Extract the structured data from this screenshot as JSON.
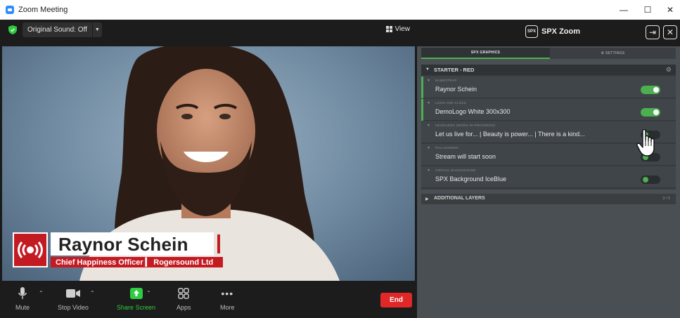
{
  "window": {
    "title": "Zoom Meeting"
  },
  "meeting": {
    "original_sound": "Original Sound: Off",
    "view_label": "View"
  },
  "lower_third": {
    "name": "Raynor Schein",
    "subtitle": "Chief Happiness Officer  ▎ Rogersound Ltd"
  },
  "toolbar": {
    "mute": "Mute",
    "stop_video": "Stop Video",
    "share_screen": "Share Screen",
    "apps": "Apps",
    "more": "More",
    "end": "End"
  },
  "panel": {
    "logo_text": "SPX",
    "title": "SPX Zoom",
    "tabs": {
      "graphics": "SPX GRAPHICS",
      "settings": "⚙ SETTINGS"
    },
    "rundown_title": "STARTER - RED",
    "items": [
      {
        "caption": "NAMESTRAP",
        "text": "Raynor Schein",
        "on": true
      },
      {
        "caption": "LOGO AND CLOCK",
        "text": "DemoLogo White 300x300",
        "on": true
      },
      {
        "caption": "HEADLINES (WORK-IN-PROGRESS)",
        "text": "Let us live for... | Beauty is power... | There is a kind...",
        "on": false
      },
      {
        "caption": "FULLSCREEN",
        "text": "Stream will start soon",
        "on": false
      },
      {
        "caption": "VIRTUAL BACKGROUND",
        "text": "SPX Background IceBlue",
        "on": false
      }
    ],
    "additional_layers": "ADDITIONAL LAYERS",
    "additional_count": "3 / 5"
  },
  "colors": {
    "accent_green": "#4caf50",
    "brand_red": "#c41b23",
    "end_red": "#e02828"
  },
  "icons": [
    "zoom-app-icon",
    "shield-icon",
    "grid-icon",
    "mic-icon",
    "camera-icon",
    "share-icon",
    "apps-icon",
    "more-icon",
    "spx-logo",
    "dock-icon",
    "close-icon",
    "gear-icon",
    "hand-cursor-icon"
  ]
}
